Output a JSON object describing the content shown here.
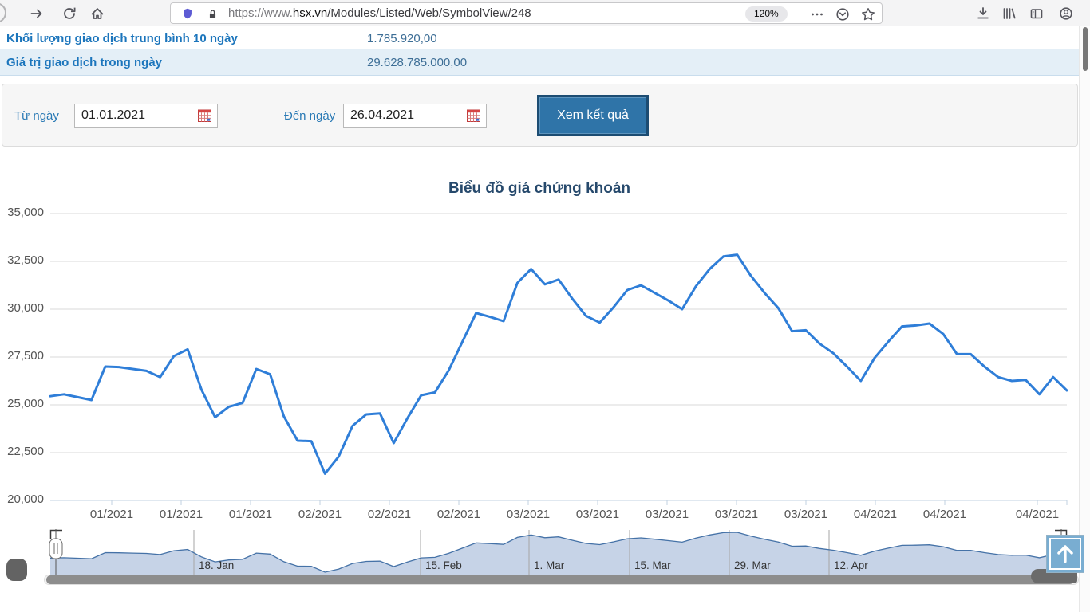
{
  "browser": {
    "url_prefix": "https://www.",
    "url_domain": "hsx.vn",
    "url_path": "/Modules/Listed/Web/SymbolView/248",
    "zoom_badge": "120%"
  },
  "stats_table": {
    "rows": [
      {
        "label": "Khối lượng giao dịch trung bình 10 ngày",
        "value": "1.785.920,00"
      },
      {
        "label": "Giá trị giao dịch trong ngày",
        "value": "29.628.785.000,00"
      }
    ]
  },
  "filter_form": {
    "from_label": "Từ ngày",
    "from_value": "01.01.2021",
    "to_label": "Đến ngày",
    "to_value": "26.04.2021",
    "submit_label": "Xem kết quả"
  },
  "chart_data": {
    "type": "line",
    "title": "Biểu đồ giá chứng khoán",
    "xlabel": "",
    "ylabel": "",
    "x_range": [
      "01.01.2021",
      "26.04.2021"
    ],
    "x_frequency": "daily trading sessions",
    "ylim": [
      20000,
      35000
    ],
    "y_tick_interval": 2500,
    "grid": true,
    "line_color": "#2f7ed8",
    "navigator_fill": "#c6d3e7",
    "navigator_line_color": "#4572a7",
    "y_tick_labels": [
      "35,000",
      "32,500",
      "30,000",
      "27,500",
      "25,000",
      "22,500",
      "20,000"
    ],
    "x_tick_labels": [
      "01/2021",
      "01/2021",
      "01/2021",
      "02/2021",
      "02/2021",
      "02/2021",
      "03/2021",
      "03/2021",
      "03/2021",
      "03/2021",
      "03/2021",
      "04/2021",
      "04/2021",
      "04/2021"
    ],
    "series": [
      {
        "values": [
          25450,
          25550,
          25400,
          25250,
          27000,
          26975,
          26875,
          26775,
          26450,
          27550,
          27900,
          25800,
          24350,
          24900,
          25100,
          26875,
          26600,
          24400,
          23125,
          23100,
          21400,
          22300,
          23900,
          24500,
          24550,
          23000,
          24300,
          25500,
          25650,
          26800,
          28300,
          29800,
          29600,
          29375,
          31375,
          32100,
          31300,
          31550,
          30550,
          29650,
          29300,
          30100,
          31000,
          31250,
          30850,
          30450,
          30000,
          31200,
          32100,
          32760,
          32850,
          31750,
          30850,
          30050,
          28850,
          28900,
          28200,
          27700,
          27000,
          26250,
          27450,
          28300,
          29100,
          29150,
          29250,
          28700,
          27650,
          27650,
          27000,
          26450,
          26250,
          26300,
          25550,
          26450,
          25750
        ]
      }
    ],
    "navigator": {
      "tick_labels": [
        "18. Jan",
        "15. Feb",
        "1. Mar",
        "15. Mar",
        "29. Mar",
        "12. Apr"
      ]
    }
  }
}
